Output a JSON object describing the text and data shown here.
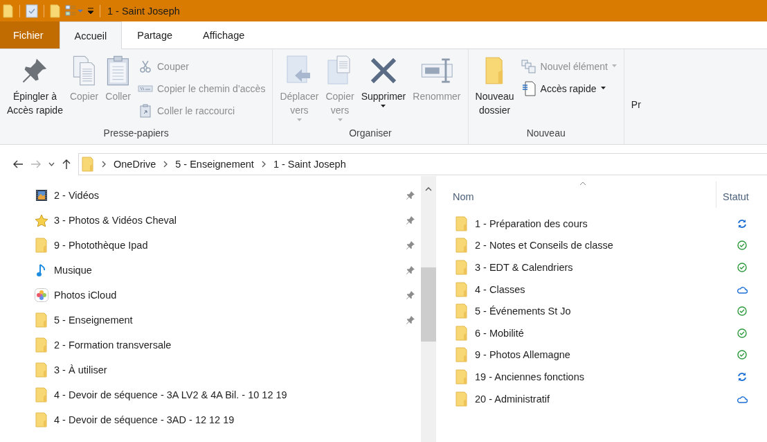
{
  "window": {
    "title": "1 - Saint Joseph"
  },
  "quick_access_toolbar": [
    {
      "kind": "folder"
    },
    {
      "kind": "properties"
    },
    {
      "kind": "newfolder"
    },
    {
      "kind": "view",
      "dropdown": true
    },
    {
      "kind": "customize"
    }
  ],
  "ribbon_tabs": [
    {
      "label": "Fichier",
      "kind": "file",
      "selected": false
    },
    {
      "label": "Accueil",
      "kind": "tab",
      "selected": true
    },
    {
      "label": "Partage",
      "kind": "tab",
      "selected": false
    },
    {
      "label": "Affichage",
      "kind": "tab",
      "selected": false
    }
  ],
  "ribbon": {
    "groups": [
      {
        "label": "Presse-papiers",
        "buttons": [
          {
            "label": "Épingler à\nAccès rapide",
            "kind": "large",
            "disabled": false,
            "dropdown": false
          },
          {
            "label": "Copier",
            "kind": "large",
            "disabled": true,
            "dropdown": false
          },
          {
            "label": "Coller",
            "kind": "large",
            "disabled": true,
            "dropdown": false
          },
          {
            "label": "Couper",
            "kind": "small",
            "disabled": true,
            "dropdown": false
          },
          {
            "label": "Copier le chemin d’accès",
            "kind": "small",
            "disabled": true,
            "dropdown": false
          },
          {
            "label": "Coller le raccourci",
            "kind": "small",
            "disabled": true,
            "dropdown": false
          }
        ]
      },
      {
        "label": "Organiser",
        "buttons": [
          {
            "label": "Déplacer\nvers",
            "kind": "large",
            "disabled": true,
            "dropdown": true
          },
          {
            "label": "Copier\nvers",
            "kind": "large",
            "disabled": true,
            "dropdown": true
          },
          {
            "label": "Supprimer",
            "kind": "large",
            "disabled": false,
            "dropdown": true
          },
          {
            "label": "Renommer",
            "kind": "large",
            "disabled": true,
            "dropdown": false
          }
        ]
      },
      {
        "label": "Nouveau",
        "buttons": [
          {
            "label": "Nouveau\ndossier",
            "kind": "large",
            "disabled": false,
            "dropdown": false
          },
          {
            "label": "Nouvel élément",
            "kind": "small",
            "disabled": true,
            "dropdown": true
          },
          {
            "label": "Accès rapide",
            "kind": "small",
            "disabled": false,
            "dropdown": true
          }
        ]
      },
      {
        "label": "Pr"
      }
    ]
  },
  "address_bar": {
    "back_disabled": false,
    "forward_disabled": true,
    "path": [
      "OneDrive",
      "5 - Enseignement",
      "1 - Saint Joseph"
    ]
  },
  "navigation_pane": {
    "items": [
      {
        "label": "2 - Vidéos",
        "kind": "video",
        "pinned": true
      },
      {
        "label": "3 - Photos & Vidéos Cheval",
        "kind": "star",
        "pinned": true
      },
      {
        "label": "9 - Photothèque Ipad",
        "kind": "folder",
        "pinned": true
      },
      {
        "label": "Musique",
        "kind": "music",
        "pinned": true
      },
      {
        "label": "Photos iCloud",
        "kind": "photos",
        "pinned": true
      },
      {
        "label": "5 - Enseignement",
        "kind": "folder",
        "pinned": true
      },
      {
        "label": "2 - Formation transversale",
        "kind": "folder",
        "pinned": false
      },
      {
        "label": "3 - À utiliser",
        "kind": "folder",
        "pinned": false
      },
      {
        "label": "4 - Devoir de séquence  - 3A LV2 & 4A Bil. - 10 12 19",
        "kind": "folder",
        "pinned": false
      },
      {
        "label": "4 - Devoir de séquence  - 3AD - 12 12 19",
        "kind": "folder",
        "pinned": false
      }
    ]
  },
  "file_list": {
    "columns": [
      {
        "label": "Nom",
        "sorted": true
      },
      {
        "label": "Statut",
        "sorted": false
      }
    ],
    "rows": [
      {
        "name": "1 - Préparation des cours",
        "kind": "sync"
      },
      {
        "name": "2 - Notes et Conseils de classe",
        "kind": "ok"
      },
      {
        "name": "3 - EDT & Calendriers",
        "kind": "ok"
      },
      {
        "name": "4 - Classes",
        "kind": "cloud"
      },
      {
        "name": "5 - Événements St Jo",
        "kind": "ok"
      },
      {
        "name": "6 - Mobilité",
        "kind": "ok"
      },
      {
        "name": "9 - Photos Allemagne",
        "kind": "ok"
      },
      {
        "name": "19 - Anciennes fonctions",
        "kind": "sync"
      },
      {
        "name": "20 - Administratif",
        "kind": "cloud"
      }
    ]
  }
}
